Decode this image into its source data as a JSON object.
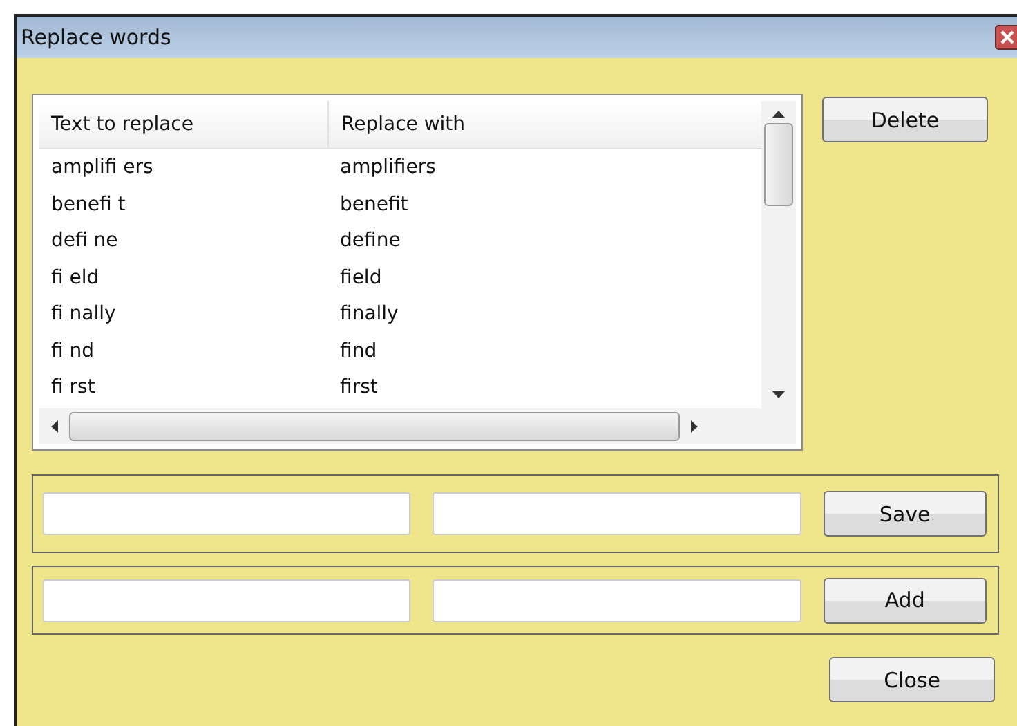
{
  "window": {
    "title": "Replace words"
  },
  "table": {
    "columns": [
      "Text to replace",
      "Replace with"
    ],
    "rows": [
      [
        "amplifi ers",
        "amplifiers"
      ],
      [
        "benefi t",
        "benefit"
      ],
      [
        "defi ne",
        "define"
      ],
      [
        "fi eld",
        "field"
      ],
      [
        "fi nally",
        "finally"
      ],
      [
        "fi nd",
        "find"
      ],
      [
        "fi rst",
        "first"
      ]
    ]
  },
  "delete_button": "Delete",
  "edit_groups": [
    {
      "button": "Save"
    },
    {
      "button": "Add"
    }
  ],
  "close_button": "Close"
}
